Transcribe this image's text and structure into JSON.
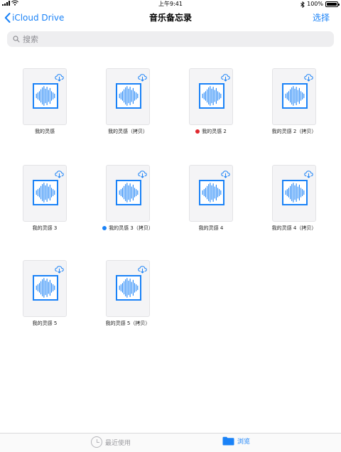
{
  "status": {
    "time": "上午9:41",
    "battery": "100%",
    "battery_level": 1.0
  },
  "nav": {
    "back_label": "iCloud Drive",
    "title": "音乐备忘录",
    "action_label": "选择"
  },
  "search": {
    "placeholder": "搜索"
  },
  "files": [
    {
      "name": "我的灵感"
    },
    {
      "name": "我的灵感（拷贝）"
    },
    {
      "name": "我的灵感 2",
      "tag_color": "#e0282e"
    },
    {
      "name": "我的灵感 2（拷贝）"
    },
    {
      "name": "我的灵感 3"
    },
    {
      "name": "我的灵感 3（拷贝）",
      "tag_color": "#1a82f7"
    },
    {
      "name": "我的灵感 4"
    },
    {
      "name": "我的灵感 4（拷贝）"
    },
    {
      "name": "我的灵感 5"
    },
    {
      "name": "我的灵感 5（拷贝）"
    }
  ],
  "tabs": {
    "recent_label": "最近使用",
    "browse_label": "浏览"
  },
  "colors": {
    "accent": "#1a82f7",
    "tag_red": "#e0282e",
    "tag_blue": "#1a82f7"
  },
  "icons": {
    "file_thumbnail": "voice-memo-waveform-icon",
    "cloud": "cloud-download-icon"
  }
}
